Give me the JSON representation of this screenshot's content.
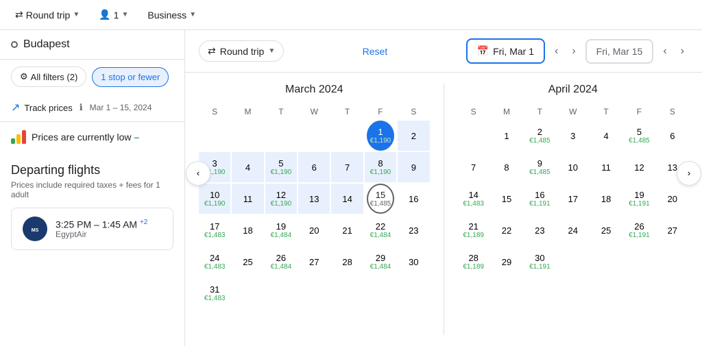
{
  "topbar": {
    "trip_type": "Round trip",
    "passengers": "1",
    "cabin": "Business"
  },
  "sidebar": {
    "search_value": "Budapest",
    "filters_label": "All filters (2)",
    "stop_filter": "1 stop or fewer",
    "track_label": "Track prices",
    "track_date": "Mar 1 – 15, 2024",
    "prices_low_text": "Prices are currently low",
    "prices_low_tag": "low",
    "departing_title": "Departing flights",
    "departing_subtitle": "Prices include required taxes + fees for 1 adult",
    "flight_time": "3:25 PM – 1:45 AM",
    "flight_time_suffix": "+2",
    "flight_carrier": "EgyptAir"
  },
  "calendar": {
    "reset_label": "Reset",
    "trip_type": "Round trip",
    "date_start": "Fri, Mar 1",
    "date_end": "Fri, Mar 15",
    "march": {
      "title": "March 2024",
      "days_of_week": [
        "S",
        "M",
        "T",
        "W",
        "T",
        "F",
        "S"
      ],
      "weeks": [
        [
          {
            "num": "",
            "price": "",
            "type": "empty"
          },
          {
            "num": "",
            "price": "",
            "type": "empty"
          },
          {
            "num": "",
            "price": "",
            "type": "empty"
          },
          {
            "num": "",
            "price": "",
            "type": "empty"
          },
          {
            "num": "",
            "price": "",
            "type": "empty"
          },
          {
            "num": "1",
            "price": "€1,190",
            "type": "selected-start"
          },
          {
            "num": "2",
            "price": "",
            "type": "in-range"
          }
        ],
        [
          {
            "num": "3",
            "price": "€1,190",
            "type": "in-range"
          },
          {
            "num": "4",
            "price": "",
            "type": "in-range"
          },
          {
            "num": "5",
            "price": "€1,190",
            "type": "in-range"
          },
          {
            "num": "6",
            "price": "",
            "type": "in-range"
          },
          {
            "num": "7",
            "price": "",
            "type": "in-range"
          },
          {
            "num": "8",
            "price": "€1,190",
            "type": "in-range"
          },
          {
            "num": "9",
            "price": "",
            "type": "in-range"
          }
        ],
        [
          {
            "num": "10",
            "price": "€1,190",
            "type": "in-range"
          },
          {
            "num": "11",
            "price": "",
            "type": "in-range"
          },
          {
            "num": "12",
            "price": "€1,190",
            "type": "in-range"
          },
          {
            "num": "13",
            "price": "",
            "type": "in-range"
          },
          {
            "num": "14",
            "price": "",
            "type": "in-range"
          },
          {
            "num": "15",
            "price": "€1,485",
            "type": "selected-end"
          },
          {
            "num": "16",
            "price": "",
            "type": "normal"
          }
        ],
        [
          {
            "num": "17",
            "price": "€1,483",
            "type": "normal"
          },
          {
            "num": "18",
            "price": "",
            "type": "normal"
          },
          {
            "num": "19",
            "price": "€1,484",
            "type": "normal"
          },
          {
            "num": "20",
            "price": "",
            "type": "normal"
          },
          {
            "num": "21",
            "price": "",
            "type": "normal"
          },
          {
            "num": "22",
            "price": "€1,484",
            "type": "normal"
          },
          {
            "num": "23",
            "price": "",
            "type": "normal"
          }
        ],
        [
          {
            "num": "24",
            "price": "€1,483",
            "type": "normal"
          },
          {
            "num": "25",
            "price": "",
            "type": "normal"
          },
          {
            "num": "26",
            "price": "€1,484",
            "type": "normal"
          },
          {
            "num": "27",
            "price": "",
            "type": "normal"
          },
          {
            "num": "28",
            "price": "",
            "type": "normal"
          },
          {
            "num": "29",
            "price": "€1,484",
            "type": "normal"
          },
          {
            "num": "30",
            "price": "",
            "type": "normal"
          }
        ],
        [
          {
            "num": "31",
            "price": "€1,483",
            "type": "normal"
          },
          {
            "num": "",
            "price": "",
            "type": "empty"
          },
          {
            "num": "",
            "price": "",
            "type": "empty"
          },
          {
            "num": "",
            "price": "",
            "type": "empty"
          },
          {
            "num": "",
            "price": "",
            "type": "empty"
          },
          {
            "num": "",
            "price": "",
            "type": "empty"
          },
          {
            "num": "",
            "price": "",
            "type": "empty"
          }
        ]
      ]
    },
    "april": {
      "title": "April 2024",
      "days_of_week": [
        "S",
        "M",
        "T",
        "W",
        "T",
        "F",
        "S"
      ],
      "weeks": [
        [
          {
            "num": "",
            "price": "",
            "type": "empty"
          },
          {
            "num": "1",
            "price": "",
            "type": "normal"
          },
          {
            "num": "2",
            "price": "€1,485",
            "type": "normal"
          },
          {
            "num": "3",
            "price": "",
            "type": "normal"
          },
          {
            "num": "4",
            "price": "",
            "type": "normal"
          },
          {
            "num": "5",
            "price": "€1,485",
            "type": "normal"
          },
          {
            "num": "6",
            "price": "",
            "type": "normal"
          }
        ],
        [
          {
            "num": "7",
            "price": "",
            "type": "normal"
          },
          {
            "num": "8",
            "price": "",
            "type": "normal"
          },
          {
            "num": "9",
            "price": "€1,485",
            "type": "normal"
          },
          {
            "num": "10",
            "price": "",
            "type": "normal"
          },
          {
            "num": "11",
            "price": "",
            "type": "normal"
          },
          {
            "num": "12",
            "price": "",
            "type": "normal"
          },
          {
            "num": "13",
            "price": "",
            "type": "normal"
          }
        ],
        [
          {
            "num": "14",
            "price": "€1,483",
            "type": "normal"
          },
          {
            "num": "15",
            "price": "",
            "type": "normal"
          },
          {
            "num": "16",
            "price": "€1,191",
            "type": "normal"
          },
          {
            "num": "17",
            "price": "",
            "type": "normal"
          },
          {
            "num": "18",
            "price": "",
            "type": "normal"
          },
          {
            "num": "19",
            "price": "€1,191",
            "type": "green"
          },
          {
            "num": "20",
            "price": "",
            "type": "normal"
          }
        ],
        [
          {
            "num": "21",
            "price": "€1,189",
            "type": "green"
          },
          {
            "num": "22",
            "price": "",
            "type": "normal"
          },
          {
            "num": "23",
            "price": "",
            "type": "normal"
          },
          {
            "num": "24",
            "price": "",
            "type": "normal"
          },
          {
            "num": "25",
            "price": "",
            "type": "normal"
          },
          {
            "num": "26",
            "price": "€1,191",
            "type": "green"
          },
          {
            "num": "27",
            "price": "",
            "type": "normal"
          }
        ],
        [
          {
            "num": "28",
            "price": "€1,189",
            "type": "green"
          },
          {
            "num": "29",
            "price": "",
            "type": "normal"
          },
          {
            "num": "30",
            "price": "€1,191",
            "type": "green"
          },
          {
            "num": "",
            "price": "",
            "type": "empty"
          },
          {
            "num": "",
            "price": "",
            "type": "empty"
          },
          {
            "num": "",
            "price": "",
            "type": "empty"
          },
          {
            "num": "",
            "price": "",
            "type": "empty"
          }
        ]
      ]
    }
  }
}
